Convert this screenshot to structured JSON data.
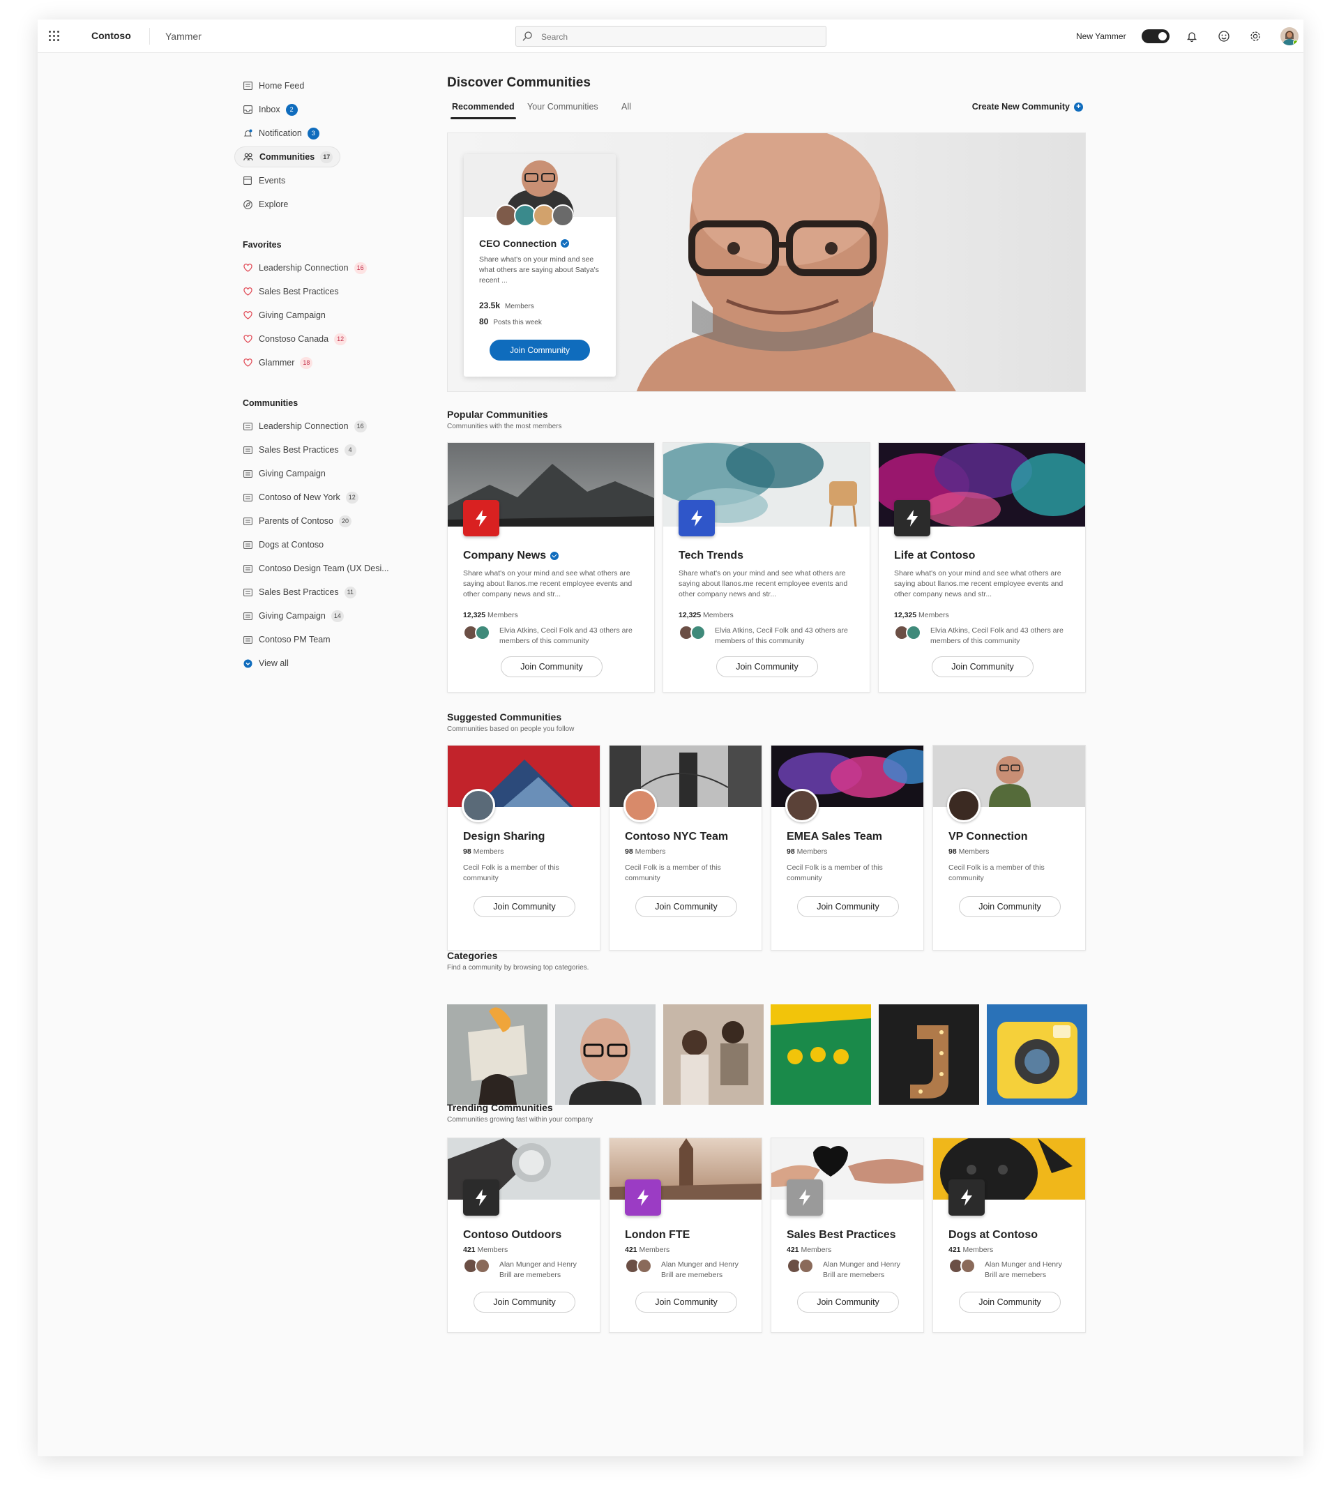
{
  "topbar": {
    "brand": "Contoso",
    "app_name": "Yammer",
    "search_placeholder": "Search",
    "new_yammer_label": "New Yammer",
    "icons": [
      "waffle-icon",
      "search-icon",
      "bell-icon",
      "smiley-icon",
      "gear-icon"
    ]
  },
  "sidebar": {
    "nav": [
      {
        "label": "Home Feed",
        "icon": "feed-icon"
      },
      {
        "label": "Inbox",
        "icon": "inbox-icon",
        "badge": "2"
      },
      {
        "label": "Notification",
        "icon": "bell-icon",
        "badge": "3"
      },
      {
        "label": "Communities",
        "icon": "people-icon",
        "badge": "17"
      },
      {
        "label": "Events",
        "icon": "calendar-icon"
      },
      {
        "label": "Explore",
        "icon": "compass-icon"
      }
    ],
    "favorites_heading": "Favorites",
    "favorites": [
      {
        "label": "Leadership Connection",
        "badge": "16"
      },
      {
        "label": "Sales Best Practices"
      },
      {
        "label": "Giving Campaign"
      },
      {
        "label": "Constoso Canada",
        "badge": "12"
      },
      {
        "label": "Glammer",
        "badge": "18"
      }
    ],
    "communities_heading": "Communities",
    "communities": [
      {
        "label": "Leadership Connection",
        "badge": "16"
      },
      {
        "label": "Sales Best Practices",
        "badge": "4"
      },
      {
        "label": "Giving Campaign"
      },
      {
        "label": "Contoso of New York",
        "badge": "12"
      },
      {
        "label": "Parents of Contoso",
        "badge": "20"
      },
      {
        "label": "Dogs at Contoso"
      },
      {
        "label": "Contoso Design Team (UX Desi..."
      },
      {
        "label": "Sales Best Practices",
        "badge": "11"
      },
      {
        "label": "Giving Campaign",
        "badge": "14"
      },
      {
        "label": "Contoso PM Team"
      }
    ],
    "view_all": "View all"
  },
  "main": {
    "title": "Discover Communities",
    "tabs": [
      "Recommended",
      "Your Communities",
      "All"
    ],
    "create_label": "Create New Community",
    "hero": {
      "title": "CEO Connection",
      "description": "Share what's on your mind and see what others are saying about Satya's recent ...",
      "members_value": "23.5k",
      "members_label": "Members",
      "posts_value": "80",
      "posts_label": "Posts this week",
      "button": "Join Community"
    },
    "popular": {
      "title": "Popular Communities",
      "subtitle": "Communities with the most members",
      "cards": [
        {
          "title": "Company News",
          "verified": true,
          "logo_color": "#d92121",
          "description": "Share what's on your mind and see what others are saying about llanos.me recent employee events and other company news and str...",
          "members_value": "12,325",
          "members_label": "Members",
          "who": "Elvia Atkins, Cecil Folk and 43 others are members of this community",
          "button": "Join Community"
        },
        {
          "title": "Tech Trends",
          "verified": false,
          "logo_color": "#2f56c9",
          "description": "Share what's on your mind and see what others are saying about llanos.me recent employee events and other company news and str...",
          "members_value": "12,325",
          "members_label": "Members",
          "who": "Elvia Atkins, Cecil Folk and 43 others are members of this community",
          "button": "Join Community"
        },
        {
          "title": "Life at Contoso",
          "verified": false,
          "logo_color": "#2b2b2b",
          "description": "Share what's on your mind and see what others are saying about llanos.me recent employee events and other company news and str...",
          "members_value": "12,325",
          "members_label": "Members",
          "who": "Elvia Atkins, Cecil Folk and 43 others are members of this community",
          "button": "Join Community"
        }
      ]
    },
    "suggested": {
      "title": "Suggested Communities",
      "subtitle": "Communities based on people you follow",
      "cards": [
        {
          "title": "Design Sharing",
          "members_value": "98",
          "members_label": "Members",
          "who": "Cecil Folk is a member of this community",
          "button": "Join Community"
        },
        {
          "title": "Contoso NYC Team",
          "members_value": "98",
          "members_label": "Members",
          "who": "Cecil Folk is a member of this community",
          "button": "Join Community"
        },
        {
          "title": "EMEA Sales Team",
          "members_value": "98",
          "members_label": "Members",
          "who": "Cecil Folk is a member of this community",
          "button": "Join Community"
        },
        {
          "title": "VP Connection",
          "members_value": "98",
          "members_label": "Members",
          "who": "Cecil Folk is a member of this community",
          "button": "Join Community"
        }
      ]
    },
    "categories": {
      "title": "Categories",
      "subtitle": "Find a community by browsing top categories."
    },
    "trending": {
      "title": "Trending Communities",
      "subtitle": "Communities growing fast within your company",
      "cards": [
        {
          "title": "Contoso Outdoors",
          "logo_color": "#2b2b2b",
          "members_value": "421",
          "members_label": "Members",
          "who": "Alan Munger and Henry Brill are memebers",
          "button": "Join Community"
        },
        {
          "title": "London FTE",
          "logo_color": "#9b3cc4",
          "members_value": "421",
          "members_label": "Members",
          "who": "Alan Munger and Henry Brill are memebers",
          "button": "Join Community"
        },
        {
          "title": "Sales Best Practices",
          "logo_color": "#9a9a9a",
          "members_value": "421",
          "members_label": "Members",
          "who": "Alan Munger and Henry Brill are memebers",
          "button": "Join Community"
        },
        {
          "title": "Dogs at Contoso",
          "logo_color": "#2b2b2b",
          "members_value": "421",
          "members_label": "Members",
          "who": "Alan Munger and Henry Brill are memebers",
          "button": "Join Community"
        }
      ]
    }
  },
  "colors": {
    "accent": "#0f6cbd",
    "favorite_heart": "#e0434f"
  }
}
